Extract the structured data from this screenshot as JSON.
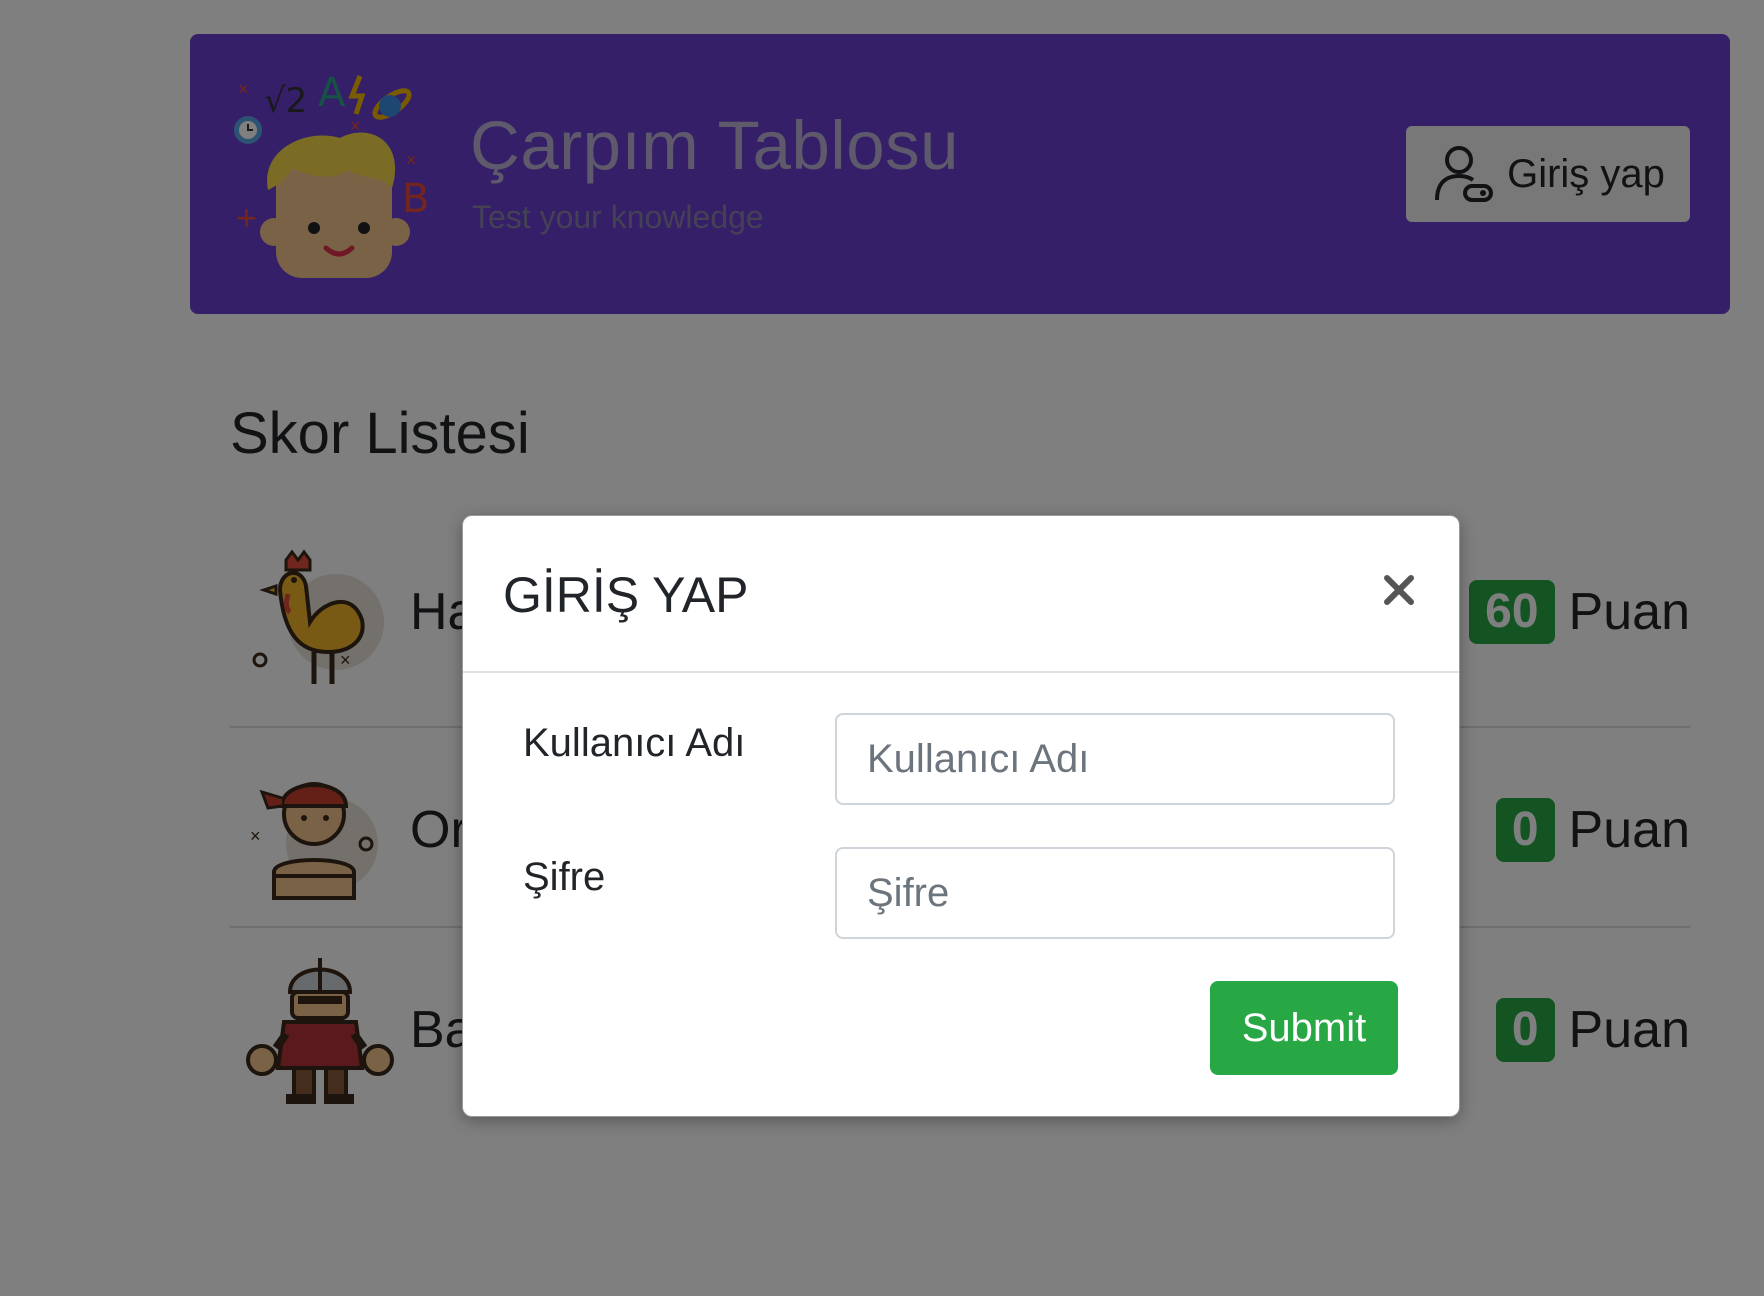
{
  "header": {
    "title": "Çarpım Tablosu",
    "subtitle": "Test your knowledge",
    "login_button": "Giriş yap",
    "background_color": "#6a3fd2"
  },
  "scoreboard": {
    "title": "Skor Listesi",
    "players": [
      {
        "name": "Ha",
        "score": "60",
        "unit": "Puan",
        "avatar": "rooster-icon"
      },
      {
        "name": "Or",
        "score": "0",
        "unit": "Puan",
        "avatar": "pirate-icon"
      },
      {
        "name": "Ba",
        "score": "0",
        "unit": "Puan",
        "avatar": "samurai-icon"
      }
    ]
  },
  "modal": {
    "title": "GİRİŞ YAP",
    "username_label": "Kullanıcı Adı",
    "username_placeholder": "Kullanıcı Adı",
    "password_label": "Şifre",
    "password_placeholder": "Şifre",
    "submit_label": "Submit",
    "close_icon": "close-icon"
  },
  "colors": {
    "success": "#28a745",
    "backdrop": "rgba(0,0,0,0.5)"
  }
}
